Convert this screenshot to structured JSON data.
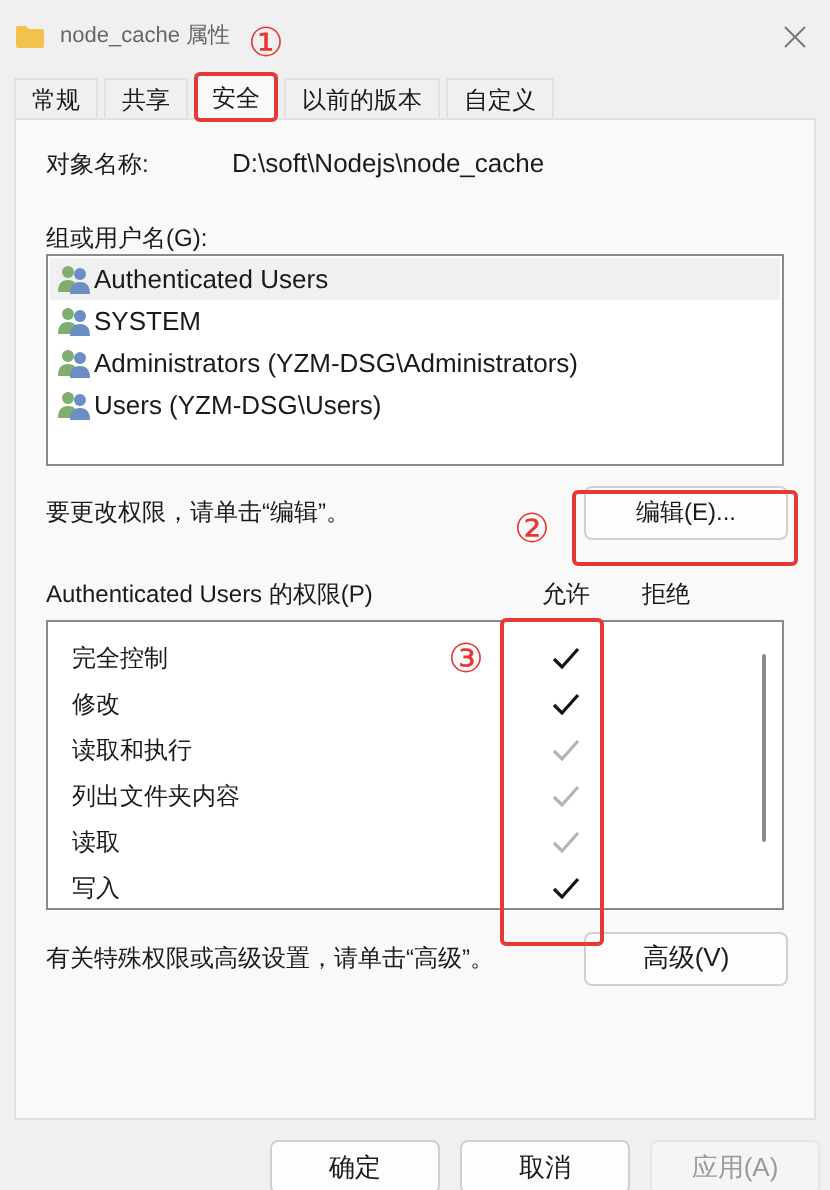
{
  "window": {
    "title": "node_cache 属性"
  },
  "tabs": [
    {
      "label": "常规",
      "selected": false
    },
    {
      "label": "共享",
      "selected": false
    },
    {
      "label": "安全",
      "selected": true
    },
    {
      "label": "以前的版本",
      "selected": false
    },
    {
      "label": "自定义",
      "selected": false
    }
  ],
  "object_name": {
    "label": "对象名称:",
    "value": "D:\\soft\\Nodejs\\node_cache"
  },
  "principals": {
    "label": "组或用户名(G):",
    "items": [
      {
        "name": "Authenticated Users",
        "selected": true
      },
      {
        "name": "SYSTEM",
        "selected": false
      },
      {
        "name": "Administrators (YZM-DSG\\Administrators)",
        "selected": false
      },
      {
        "name": "Users (YZM-DSG\\Users)",
        "selected": false
      }
    ]
  },
  "edit_hint": "要更改权限，请单击“编辑”。",
  "edit_button": "编辑(E)...",
  "permissions": {
    "label": "Authenticated Users 的权限(P)",
    "allow_header": "允许",
    "deny_header": "拒绝",
    "rows": [
      {
        "name": "完全控制",
        "allowed": true,
        "inherited": false
      },
      {
        "name": "修改",
        "allowed": true,
        "inherited": false
      },
      {
        "name": "读取和执行",
        "allowed": true,
        "inherited": true
      },
      {
        "name": "列出文件夹内容",
        "allowed": true,
        "inherited": true
      },
      {
        "name": "读取",
        "allowed": true,
        "inherited": true
      },
      {
        "name": "写入",
        "allowed": true,
        "inherited": false
      }
    ]
  },
  "advanced_hint": "有关特殊权限或高级设置，请单击“高级”。",
  "advanced_button": "高级(V)",
  "buttons": [
    {
      "label": "确定",
      "disabled": false
    },
    {
      "label": "取消",
      "disabled": false
    },
    {
      "label": "应用(A)",
      "disabled": true
    }
  ],
  "annotations": [
    {
      "label": "①"
    },
    {
      "label": "②"
    },
    {
      "label": "③"
    }
  ]
}
